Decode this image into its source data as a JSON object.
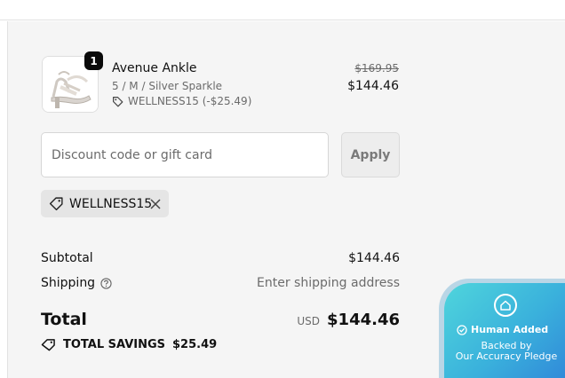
{
  "product": {
    "name": "Avenue Ankle",
    "variant": "5 / M / Silver Sparkle",
    "discount": "WELLNESS15 (-$25.49)",
    "original_price": "$169.95",
    "price": "$144.46",
    "quantity": "1",
    "image_icon": "sandal-image"
  },
  "discount_form": {
    "placeholder": "Discount code or gift card",
    "apply_label": "Apply"
  },
  "applied_code": {
    "code": "WELLNESS15",
    "tag_icon": "tag-icon",
    "remove_icon": "close-icon"
  },
  "totals": {
    "subtotal_label": "Subtotal",
    "subtotal_value": "$144.46",
    "shipping_label": "Shipping",
    "shipping_value": "Enter shipping address",
    "help_icon": "help-icon",
    "total_label": "Total",
    "currency": "USD",
    "total_value": "$144.46",
    "savings_label": "TOTAL SAVINGS",
    "savings_value": "$25.49"
  },
  "badge": {
    "title": "Human Added",
    "subtitle_line1": "Backed by",
    "subtitle_line2": "Our Accuracy Pledge"
  },
  "colors": {
    "panel_bg": "#f5f5f5",
    "badge_gradient_start": "#4fd5dc",
    "badge_gradient_end": "#2e7fd8"
  }
}
